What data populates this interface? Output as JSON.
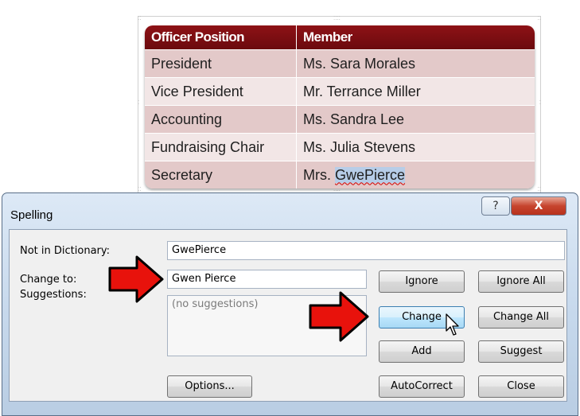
{
  "table": {
    "headers": [
      "Officer Position",
      "Member"
    ],
    "rows": [
      [
        "President",
        "Ms. Sara Morales"
      ],
      [
        "Vice President",
        "Mr. Terrance Miller"
      ],
      [
        "Accounting",
        "Ms. Sandra Lee"
      ],
      [
        "Fundraising Chair",
        "Ms. Julia Stevens"
      ]
    ],
    "last_row": {
      "position": "Secretary",
      "member_prefix": "Mrs. ",
      "member_flagged": "GwePierce"
    }
  },
  "dialog": {
    "title": "Spelling",
    "help_glyph": "?",
    "close_glyph": "X",
    "not_in_dictionary_label": "Not in Dictionary:",
    "not_in_dictionary_value": "GwePierce",
    "change_to_label": "Change to:",
    "change_to_value": "Gwen Pierce",
    "suggestions_label": "Suggestions:",
    "suggestions_placeholder": "(no suggestions)",
    "buttons": {
      "ignore": "Ignore",
      "ignore_all": "Ignore All",
      "change": "Change",
      "change_all": "Change All",
      "add": "Add",
      "suggest": "Suggest",
      "options": "Options...",
      "autocorrect": "AutoCorrect",
      "close": "Close"
    }
  },
  "colors": {
    "table_header": "#7c0d12",
    "table_row_odd": "#e3c9c9",
    "table_row_even": "#f2e6e6",
    "highlight": "#b7cde8",
    "arrow_red": "#e8120c",
    "hover_button": "#bee6fd"
  },
  "icons": [
    "red-arrow-icon",
    "mouse-pointer-icon",
    "help-icon",
    "close-icon"
  ]
}
